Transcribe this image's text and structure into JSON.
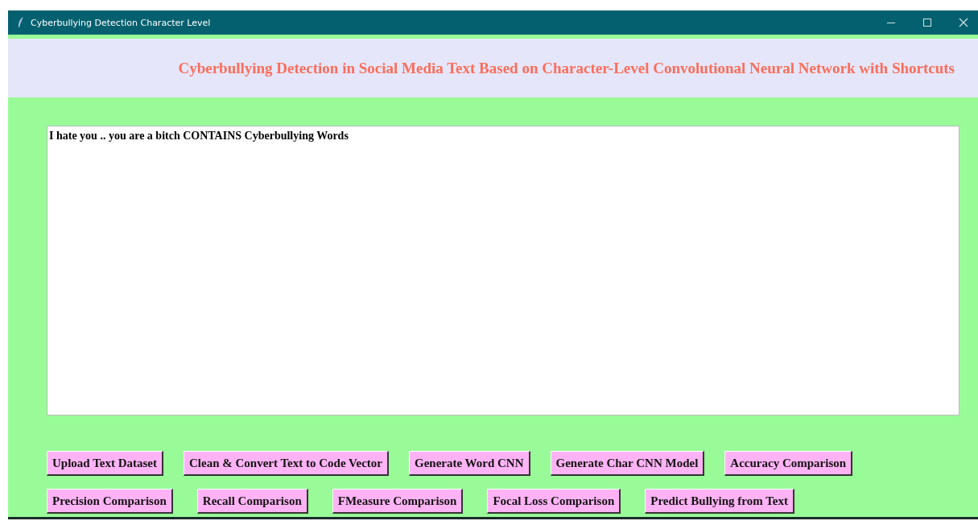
{
  "window": {
    "title": "Cyberbullying Detection Character Level"
  },
  "heading": "Cyberbullying Detection in Social Media Text Based on Character-Level Convolutional Neural Network with Shortcuts",
  "output_text": "I hate you .. you are a bitch CONTAINS Cyberbullying Words",
  "button_rows": [
    [
      "Upload Text Dataset",
      "Clean & Convert Text to Code Vector",
      "Generate Word CNN",
      "Generate Char CNN Model",
      "Accuracy Comparison"
    ],
    [
      "Precision Comparison",
      "Recall Comparison",
      "FMeasure Comparison",
      "Focal Loss Comparison",
      "Predict Bullying from Text"
    ]
  ]
}
